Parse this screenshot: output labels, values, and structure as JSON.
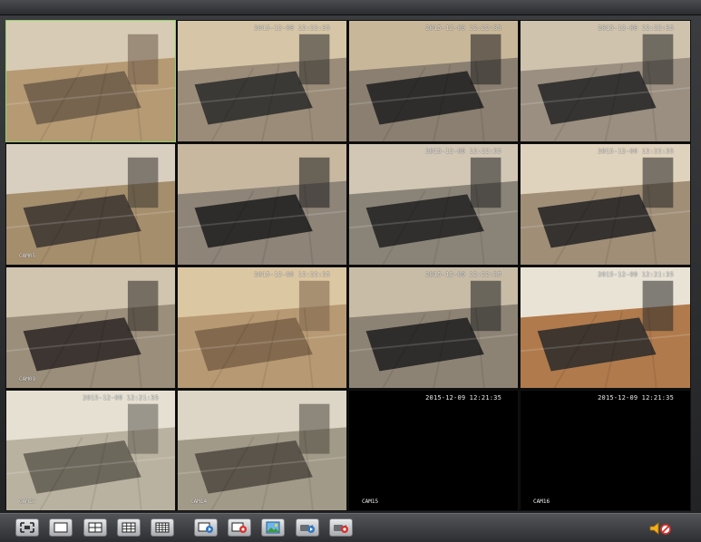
{
  "colors": {
    "selected_border": "#8fd26a",
    "overlay_text": "#e9e9e9",
    "toolbar_bg": "#3a3c40",
    "record_red": "#d9302c",
    "play_blue": "#2f78c4"
  },
  "cameras": [
    {
      "id": 1,
      "timestamp": "",
      "label": "",
      "scene": "office-floor-with-red-chair",
      "selected": true
    },
    {
      "id": 2,
      "timestamp": "2015-12-09 12:22:35",
      "label": "",
      "scene": "pc-room-counter"
    },
    {
      "id": 3,
      "timestamp": "2015-12-09 12:22:35",
      "label": "",
      "scene": "pc-room-vending-machine"
    },
    {
      "id": 4,
      "timestamp": "2015-12-09 12:22:35",
      "label": "",
      "scene": "pc-room-rows"
    },
    {
      "id": 5,
      "timestamp": "",
      "label": "CAM05",
      "scene": "snack-counter-freezer"
    },
    {
      "id": 6,
      "timestamp": "",
      "label": "",
      "scene": "pc-room-seated-person"
    },
    {
      "id": 7,
      "timestamp": "2015-12-09 12:22:35",
      "label": "",
      "scene": "pc-room-booths"
    },
    {
      "id": 8,
      "timestamp": "2015-12-09 12:22:35",
      "label": "",
      "scene": "pc-room-corner"
    },
    {
      "id": 9,
      "timestamp": "",
      "label": "CAM09",
      "scene": "pc-room-entrance"
    },
    {
      "id": 10,
      "timestamp": "2015-12-09 12:22:35",
      "label": "",
      "scene": "tiled-floor-hall"
    },
    {
      "id": 11,
      "timestamp": "2015-12-09 12:22:35",
      "label": "",
      "scene": "pc-room-kiosk"
    },
    {
      "id": 12,
      "timestamp": "2015-12-09 12:21:35",
      "label": "",
      "scene": "lounge-tables"
    },
    {
      "id": 13,
      "timestamp": "2015-12-09 12:21:35",
      "label": "CAM13",
      "scene": "staircase-down"
    },
    {
      "id": 14,
      "timestamp": "",
      "label": "CAM14",
      "scene": "staircase-landing"
    },
    {
      "id": 15,
      "timestamp": "2015-12-09 12:21:35",
      "label": "CAM15",
      "scene": "no-signal"
    },
    {
      "id": 16,
      "timestamp": "2015-12-09 12:21:35",
      "label": "CAM16",
      "scene": "no-signal"
    }
  ],
  "toolbar": {
    "buttons": [
      {
        "name": "fullscreen-button",
        "icon": "fullscreen-icon"
      },
      {
        "name": "layout-1-button",
        "icon": "layout-single-icon"
      },
      {
        "name": "layout-4-button",
        "icon": "layout-quad-icon"
      },
      {
        "name": "layout-9-button",
        "icon": "layout-nine-icon"
      },
      {
        "name": "layout-16-button",
        "icon": "layout-sixteen-icon"
      },
      {
        "name": "playback-button",
        "icon": "play-icon"
      },
      {
        "name": "record-button",
        "icon": "record-icon"
      },
      {
        "name": "snapshot-button",
        "icon": "snapshot-icon"
      },
      {
        "name": "remote-play-button",
        "icon": "camera-play-icon"
      },
      {
        "name": "remote-record-button",
        "icon": "camera-record-icon"
      }
    ],
    "volume": {
      "icon": "speaker-muted-icon",
      "muted": true
    }
  }
}
